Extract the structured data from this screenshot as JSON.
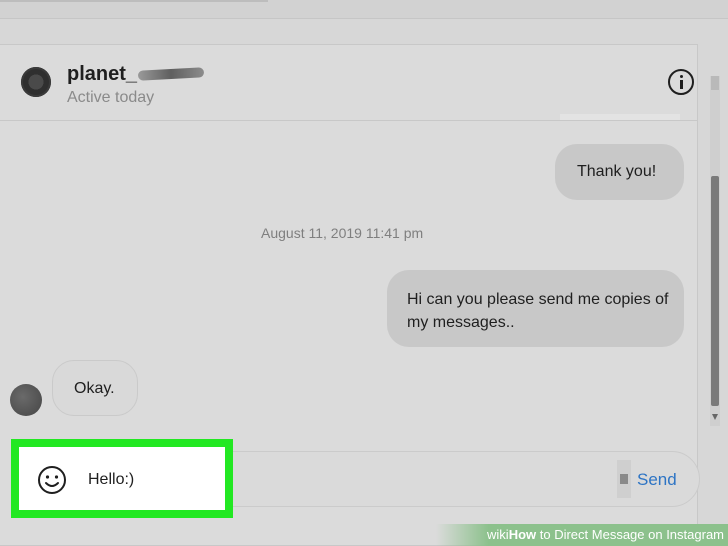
{
  "header": {
    "username": "planet_",
    "status": "Active today"
  },
  "messages": [
    {
      "text": "Thank you!",
      "direction": "outgoing"
    },
    {
      "text": "Hi can you please send me copies of my messages..",
      "direction": "outgoing"
    },
    {
      "text": "Okay.",
      "direction": "incoming"
    }
  ],
  "timestamp": "August 11, 2019 11:41 pm",
  "composer": {
    "value": "Hello:)",
    "send_label": "Send"
  },
  "watermark": {
    "prefix": "wiki",
    "bold": "How",
    "rest": " to Direct Message on Instagram"
  },
  "colors": {
    "highlight": "#22e822",
    "send": "#2d74c4"
  },
  "icons": {
    "info": "info-icon",
    "emoji": "emoji-icon"
  }
}
